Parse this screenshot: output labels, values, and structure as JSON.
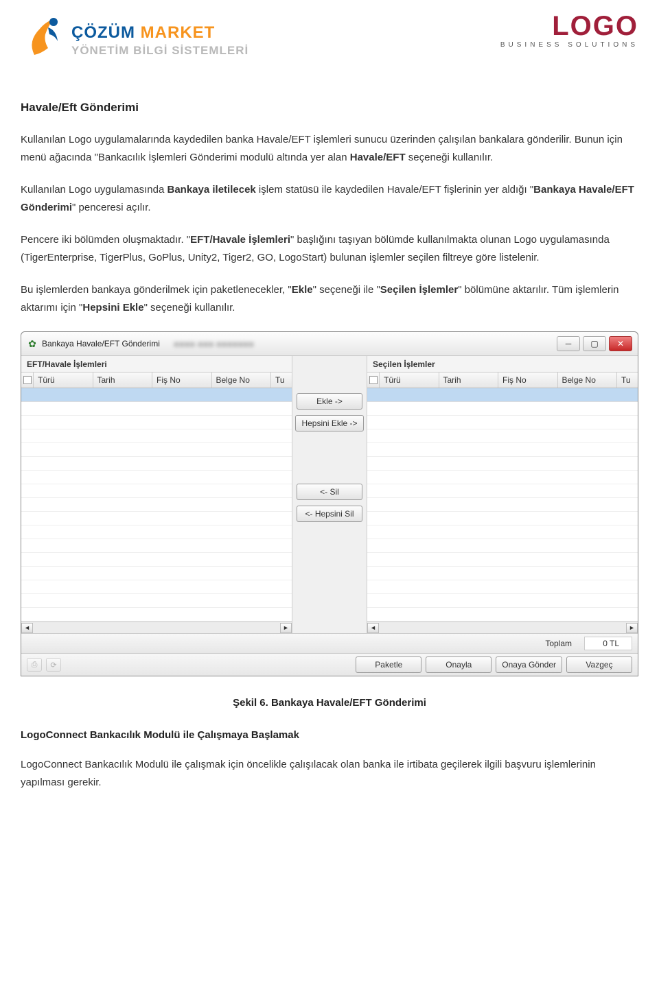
{
  "header": {
    "left_logo": {
      "line1_a": "ÇÖZÜM ",
      "line1_b": "MARKET",
      "line2": "YÖNETİM BİLGİ SİSTEMLERİ"
    },
    "right_logo": {
      "brand": "LOGO",
      "tag": "BUSINESS SOLUTIONS"
    }
  },
  "doc": {
    "title": "Havale/Eft Gönderimi",
    "p1": "Kullanılan Logo uygulamalarında kaydedilen banka Havale/EFT işlemleri sunucu üzerinden çalışılan bankalara gönderilir. Bunun için menü ağacında \"Bankacılık İşlemleri Gönderimi modulü altında yer alan ",
    "p1_b1": "Havale/EFT",
    "p1_tail": " seçeneği kullanılır.",
    "p2_a": "Kullanılan Logo uygulamasında ",
    "p2_b1": "Bankaya iletilecek",
    "p2_b": " işlem statüsü ile kaydedilen Havale/EFT fişlerinin yer aldığı \"",
    "p2_b2": "Bankaya Havale/EFT Gönderimi",
    "p2_c": "\" penceresi açılır.",
    "p3_a": "Pencere iki bölümden oluşmaktadır. \"",
    "p3_b1": "EFT/Havale İşlemleri",
    "p3_b": "\" başlığını taşıyan bölümde kullanılmakta olunan Logo uygulamasında (TigerEnterprise, TigerPlus, GoPlus, Unity2, Tiger2, GO, LogoStart) bulunan işlemler seçilen filtreye göre listelenir.",
    "p4_a": "Bu işlemlerden bankaya gönderilmek için paketlenecekler, \"",
    "p4_b1": "Ekle",
    "p4_b": "\" seçeneği ile \"",
    "p4_b2": "Seçilen İşlemler",
    "p4_c": "\" bölümüne aktarılır. Tüm işlemlerin aktarımı için \"",
    "p4_b3": "Hepsini Ekle",
    "p4_d": "\" seçeneği kullanılır."
  },
  "window": {
    "title": "Bankaya Havale/EFT Gönderimi",
    "left_header": "EFT/Havale İşlemleri",
    "right_header": "Seçilen İşlemler",
    "cols": {
      "c1": "Türü",
      "c2": "Tarih",
      "c3": "Fiş No",
      "c4": "Belge No",
      "c5": "Tu"
    },
    "btns": {
      "ekle": "Ekle ->",
      "hepsini_ekle": "Hepsini Ekle ->",
      "sil": "<- Sil",
      "hepsini_sil": "<- Hepsini Sil",
      "paketle": "Paketle",
      "onayla": "Onayla",
      "onaya_gonder": "Onaya Gönder",
      "vazgec": "Vazgeç"
    },
    "totals": {
      "label": "Toplam",
      "value": "0 TL"
    }
  },
  "caption": "Şekil 6. Bankaya Havale/EFT Gönderimi",
  "section2": {
    "heading": "LogoConnect Bankacılık Modulü ile Çalışmaya Başlamak",
    "p": "LogoConnect Bankacılık Modulü ile çalışmak için öncelikle çalışılacak olan banka ile irtibata geçilerek ilgili başvuru işlemlerinin yapılması gerekir."
  }
}
